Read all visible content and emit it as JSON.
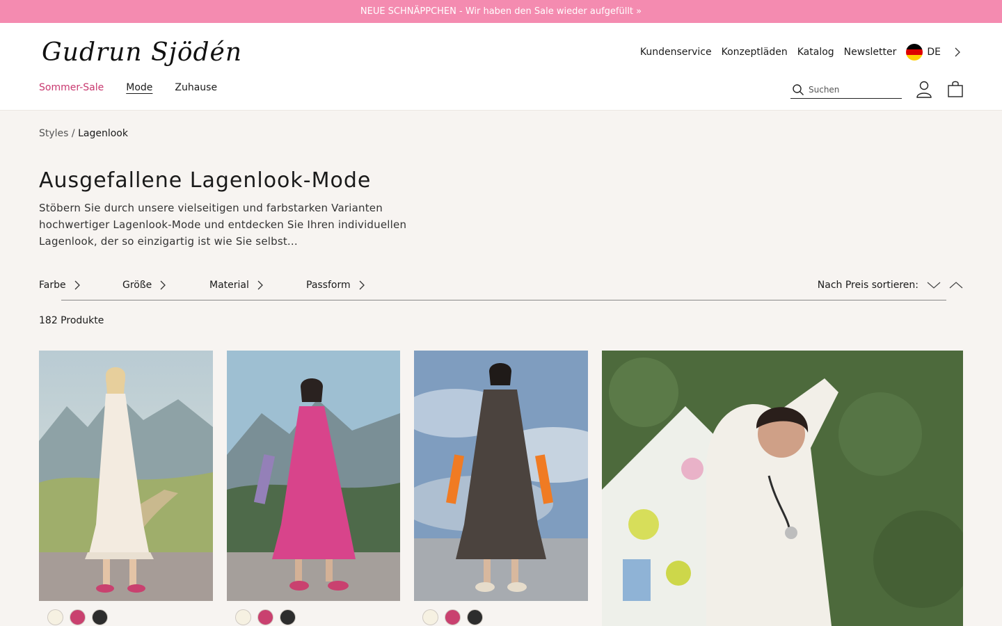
{
  "promo": {
    "text": "NEUE SCHNÄPPCHEN - Wir haben den Sale wieder aufgefüllt »"
  },
  "brand": {
    "logo_text": "Gudrun Sjödén"
  },
  "utility_nav": [
    "Kundenservice",
    "Konzeptläden",
    "Katalog",
    "Newsletter"
  ],
  "language": {
    "code": "DE",
    "flag_icon": "germany-flag-icon"
  },
  "main_nav": [
    {
      "label": "Sommer-Sale",
      "style": "sale"
    },
    {
      "label": "Mode",
      "style": "active"
    },
    {
      "label": "Zuhause",
      "style": "normal"
    }
  ],
  "search": {
    "placeholder": "Suchen",
    "value": "",
    "icon": "search-icon"
  },
  "header_icons": [
    "account-icon",
    "shopping-bag-icon"
  ],
  "breadcrumb": {
    "parent": "Styles",
    "separator": " / ",
    "current": "Lagenlook"
  },
  "page": {
    "title": "Ausgefallene Lagenlook-Mode",
    "intro": "Stöbern Sie durch unsere vielseitigen und farbstarken Varianten hochwertiger Lagenlook-Mode und entdecken Sie Ihren individuellen Lagenlook, der so einzigartig ist wie Sie selbst..."
  },
  "filters": [
    "Farbe",
    "Größe",
    "Material",
    "Passform"
  ],
  "sort": {
    "label": "Nach Preis sortieren:",
    "down_icon": "chevron-down-icon",
    "up_icon": "chevron-up-icon"
  },
  "results": {
    "count_text": "182 Produkte"
  },
  "products": [
    {
      "image": "model in cream tiered maxi dress, mountain backdrop",
      "swatches": [
        "#f6f1e2",
        "#c9416f",
        "#2d2d2d"
      ]
    },
    {
      "image": "model in pink tiered midi dress, mountain backdrop",
      "swatches": [
        "#f6f1e2",
        "#c9416f",
        "#2d2d2d"
      ]
    },
    {
      "image": "model in dark brown tiered dress with orange sleeves, sky backdrop",
      "swatches": [
        "#f6f1e2",
        "#c9416f",
        "#2d2d2d"
      ]
    },
    {
      "image": "model in white tunic with colorful scarf, green wall",
      "swatches": []
    }
  ],
  "colors": {
    "promo_bg": "#f48bb0",
    "sale_text": "#c8386f",
    "page_bg": "#f7f4f1"
  }
}
